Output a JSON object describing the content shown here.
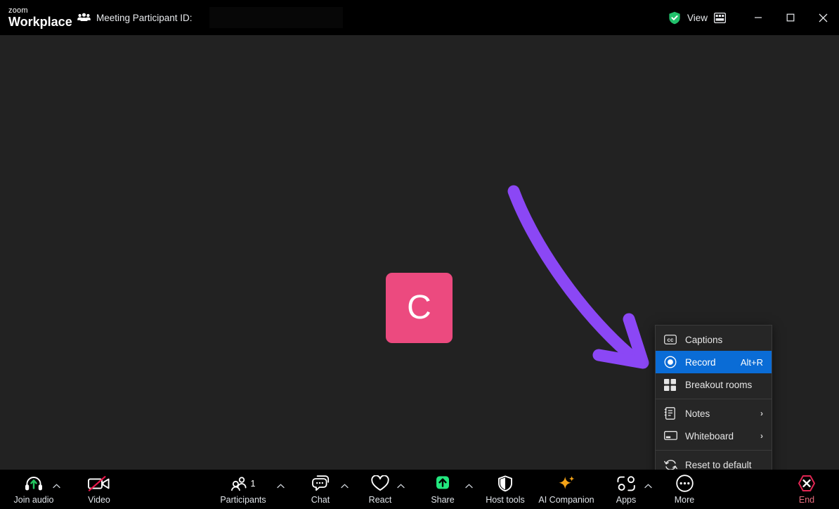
{
  "window": {
    "brand_line1": "zoom",
    "brand_line2": "Workplace",
    "participant_id_label": "Meeting Participant ID:",
    "participant_id_value": "",
    "participants_icon": "people-group-icon",
    "security_icon": "green-shield-check-icon",
    "view_label": "View",
    "view_icon": "gallery-grid-icon",
    "minimize_icon": "minimize-icon",
    "maximize_icon": "maximize-icon",
    "close_icon": "close-icon"
  },
  "stage": {
    "background_color": "#222222",
    "avatar": {
      "initial": "C",
      "color": "#ec4a7f"
    },
    "annotation": {
      "type": "curved-arrow",
      "color": "#8b47f5",
      "points_to": "Record"
    }
  },
  "context_menu": {
    "background_color": "#262626",
    "highlight_color": "#0a6cd6",
    "items": [
      {
        "label": "Captions",
        "icon": "closed-caption-icon",
        "shortcut": "",
        "submenu": false,
        "active": false
      },
      {
        "label": "Record",
        "icon": "record-circle-icon",
        "shortcut": "Alt+R",
        "submenu": false,
        "active": true
      },
      {
        "label": "Breakout rooms",
        "icon": "breakout-grid-icon",
        "shortcut": "",
        "submenu": false,
        "active": false
      },
      {
        "label": "Notes",
        "icon": "notebook-icon",
        "shortcut": "",
        "submenu": true,
        "active": false
      },
      {
        "label": "Whiteboard",
        "icon": "whiteboard-icon",
        "shortcut": "",
        "submenu": true,
        "active": false
      },
      {
        "label": "Reset to default",
        "icon": "refresh-arrows-icon",
        "shortcut": "",
        "submenu": false,
        "active": false
      }
    ]
  },
  "toolbar": {
    "background_color": "#000000",
    "items": [
      {
        "label": "Join audio",
        "icon": "headset-join-audio-icon",
        "caret": true,
        "count": ""
      },
      {
        "label": "Video",
        "icon": "camera-off-icon",
        "caret": false,
        "count": ""
      },
      {
        "label": "Participants",
        "icon": "participants-icon",
        "caret": true,
        "count": "1"
      },
      {
        "label": "Chat",
        "icon": "chat-bubble-icon",
        "caret": true,
        "count": ""
      },
      {
        "label": "React",
        "icon": "heart-react-icon",
        "caret": true,
        "count": ""
      },
      {
        "label": "Share",
        "icon": "share-screen-icon",
        "caret": true,
        "count": ""
      },
      {
        "label": "Host tools",
        "icon": "shield-host-tools-icon",
        "caret": false,
        "count": ""
      },
      {
        "label": "AI Companion",
        "icon": "ai-sparkles-icon",
        "caret": false,
        "count": ""
      },
      {
        "label": "Apps",
        "icon": "apps-icon",
        "caret": true,
        "count": ""
      },
      {
        "label": "More",
        "icon": "more-ellipsis-icon",
        "caret": false,
        "count": ""
      }
    ],
    "end_button": {
      "label": "End",
      "icon": "end-call-hexagon-icon",
      "color": "#e02653"
    }
  }
}
